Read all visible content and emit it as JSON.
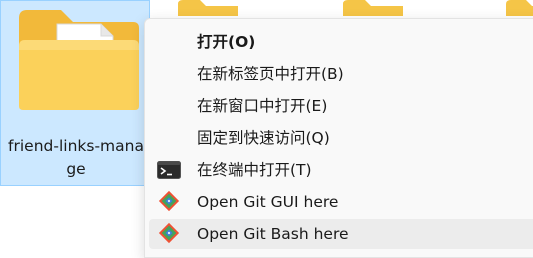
{
  "explorer": {
    "selected_item": {
      "name": "friend-links-manage"
    }
  },
  "context_menu": {
    "items": [
      {
        "label": "打开(O)",
        "bold": true,
        "icon": ""
      },
      {
        "label": "在新标签页中打开(B)",
        "icon": ""
      },
      {
        "label": "在新窗口中打开(E)",
        "icon": ""
      },
      {
        "label": "固定到快速访问(Q)",
        "icon": ""
      },
      {
        "label": "在终端中打开(T)",
        "icon": "terminal-icon"
      },
      {
        "label": "Open Git GUI here",
        "icon": "git-gui-icon"
      },
      {
        "label": "Open Git Bash here",
        "icon": "git-bash-icon",
        "hovered": true
      }
    ]
  },
  "colors": {
    "selection_bg": "#cce8ff",
    "selection_border": "#99d1ff",
    "folder_yellow": "#f8c93c",
    "menu_bg": "#f9f9f9",
    "hover_bg": "#ececec"
  }
}
